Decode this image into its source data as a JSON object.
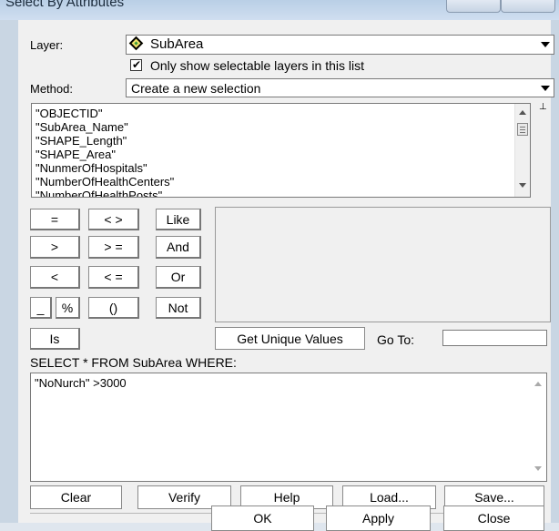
{
  "window": {
    "title": "Select By Attributes"
  },
  "layer": {
    "label": "Layer:",
    "value": "SubArea",
    "icon": "layer-icon",
    "checkbox_label": "Only show selectable layers in this list",
    "checkbox_checked": true,
    "checkmark": "✔"
  },
  "method": {
    "label": "Method:",
    "value": "Create a new selection"
  },
  "fields": {
    "items": [
      "\"OBJECTID\"",
      "\"SubArea_Name\"",
      "\"SHAPE_Length\"",
      "\"SHAPE_Area\"",
      "\"NunmerOfHospitals\"",
      "\"NumberOfHealthCenters\"",
      "\"NumberOfHealthPosts\""
    ]
  },
  "operators": {
    "eq": "=",
    "ne": "< >",
    "like": "Like",
    "gt": ">",
    "ge": "> =",
    "and": "And",
    "lt": "<",
    "le": "< =",
    "or": "Or",
    "underscore": "_",
    "percent": "%",
    "parens": "()",
    "not": "Not",
    "is": "Is"
  },
  "unique": {
    "button": "Get Unique Values",
    "goto_label": "Go To:",
    "goto_value": ""
  },
  "sql": {
    "prefix": "SELECT * FROM SubArea WHERE:",
    "expression": "\"NoNurch\" >3000"
  },
  "actions": {
    "clear": "Clear",
    "verify": "Verify",
    "help": "Help",
    "load": "Load...",
    "save": "Save..."
  },
  "footer": {
    "ok": "OK",
    "apply": "Apply",
    "close": "Close"
  },
  "colors": {
    "panel": "#f0f0f0",
    "frame": "#dfe6ee",
    "titlebar": "#b9cfe6"
  }
}
